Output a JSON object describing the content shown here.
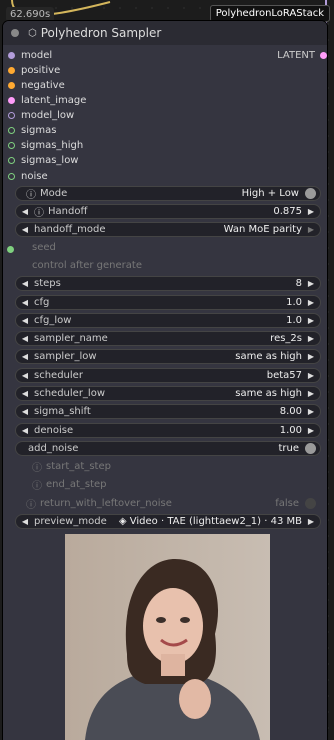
{
  "timer": "62.690s",
  "stack_label": "PolyhedronLoRAStack",
  "node": {
    "title": "Polyhedron Sampler",
    "title_glyph": "⬡",
    "output_label": "LATENT",
    "inputs": [
      {
        "label": "model",
        "color": "#b39ddb",
        "kind": "dot"
      },
      {
        "label": "positive",
        "color": "#ffa931",
        "kind": "dot"
      },
      {
        "label": "negative",
        "color": "#ffa931",
        "kind": "dot"
      },
      {
        "label": "latent_image",
        "color": "#ff9cf9",
        "kind": "dot"
      },
      {
        "label": "model_low",
        "color": "#b39ddb",
        "kind": "ring"
      },
      {
        "label": "sigmas",
        "color": "#7fd07f",
        "kind": "ring"
      },
      {
        "label": "sigmas_high",
        "color": "#7fd07f",
        "kind": "ring"
      },
      {
        "label": "sigmas_low",
        "color": "#7fd07f",
        "kind": "ring"
      },
      {
        "label": "noise",
        "color": "#7fd07f",
        "kind": "ring"
      }
    ],
    "widgets": {
      "mode": {
        "label": "Mode",
        "value": "High + Low"
      },
      "handoff": {
        "label": "Handoff",
        "value": "0.875"
      },
      "handoff_mode": {
        "label": "handoff_mode",
        "value": "Wan MoE parity"
      },
      "seed": {
        "label": "seed"
      },
      "control_after_generate": {
        "label": "control after generate"
      },
      "steps": {
        "label": "steps",
        "value": "8"
      },
      "cfg": {
        "label": "cfg",
        "value": "1.0"
      },
      "cfg_low": {
        "label": "cfg_low",
        "value": "1.0"
      },
      "sampler_name": {
        "label": "sampler_name",
        "value": "res_2s"
      },
      "sampler_low": {
        "label": "sampler_low",
        "value": "same as high"
      },
      "scheduler": {
        "label": "scheduler",
        "value": "beta57"
      },
      "scheduler_low": {
        "label": "scheduler_low",
        "value": "same as high"
      },
      "sigma_shift": {
        "label": "sigma_shift",
        "value": "8.00"
      },
      "denoise": {
        "label": "denoise",
        "value": "1.00"
      },
      "add_noise": {
        "label": "add_noise",
        "value": "true"
      },
      "start_at_step": {
        "label": "start_at_step"
      },
      "end_at_step": {
        "label": "end_at_step"
      },
      "return_with_leftover_noise": {
        "label": "return_with_leftover_noise",
        "value": "false"
      },
      "preview_mode": {
        "label": "preview_mode",
        "value": "◈ Video · TAE (lighttaew2_1) · 43 MB"
      }
    }
  }
}
